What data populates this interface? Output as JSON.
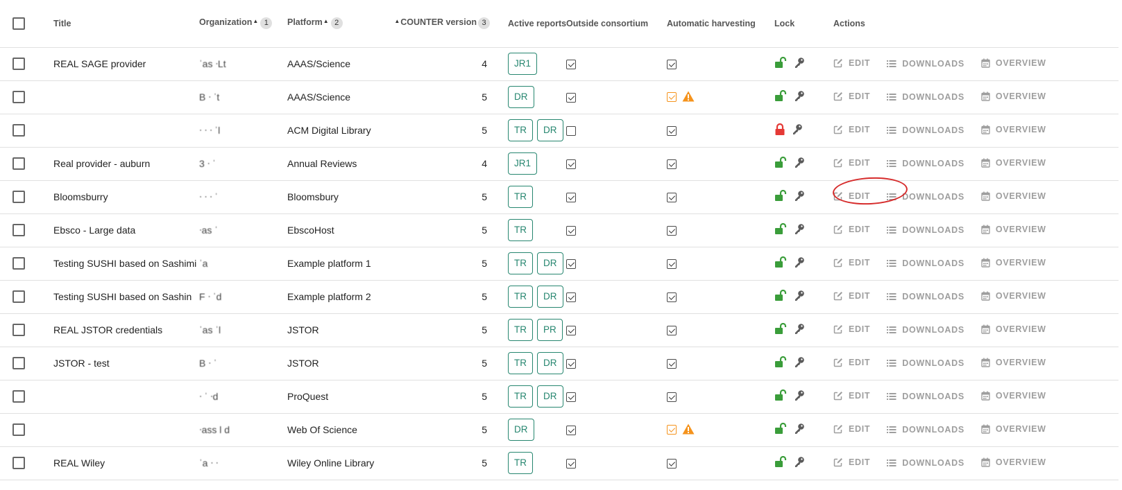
{
  "header": {
    "title": "Title",
    "organization": "Organization",
    "organization_sort": "1",
    "platform": "Platform",
    "platform_sort": "2",
    "counter_version": "COUNTER version",
    "counter_sort": "3",
    "active_reports": "Active reports",
    "outside_consortium": "Outside consortium",
    "automatic_harvesting": "Automatic harvesting",
    "lock": "Lock",
    "actions": "Actions"
  },
  "actions": {
    "edit": "EDIT",
    "downloads": "DOWNLOADS",
    "overview": "OVERVIEW"
  },
  "colors": {
    "accent": "#26866f",
    "unlocked": "#3a9d3a",
    "locked": "#e53935",
    "warning": "#f5931c",
    "action_text": "#9e9e9e",
    "highlight": "#d62b2b"
  },
  "rows": [
    {
      "title": "REAL SAGE provider",
      "org": "ˈas  ᐧLt",
      "platform": "AAAS/Science",
      "version": "4",
      "reports": [
        "JR1"
      ],
      "outside": true,
      "harvest": true,
      "harvest_warn": false,
      "locked": false
    },
    {
      "title": "",
      "org": "B ᐧ  ˈt",
      "platform": "AAAS/Science",
      "version": "5",
      "reports": [
        "DR"
      ],
      "outside": true,
      "harvest": true,
      "harvest_warn": true,
      "locked": false
    },
    {
      "title": "",
      "org": "ᐧ ᐧ  ᐧ  ˈl",
      "platform": "ACM Digital Library",
      "version": "5",
      "reports": [
        "TR",
        "DR"
      ],
      "outside": false,
      "harvest": true,
      "harvest_warn": false,
      "locked": true
    },
    {
      "title": "Real provider - auburn",
      "org": "3 ᐧ  ˈ",
      "platform": "Annual Reviews",
      "version": "4",
      "reports": [
        "JR1"
      ],
      "outside": true,
      "harvest": true,
      "harvest_warn": false,
      "locked": false
    },
    {
      "title": "Bloomsburry",
      "org": "ᐧ ᐧ ᐧ  ˈ",
      "platform": "Bloomsbury",
      "version": "5",
      "reports": [
        "TR"
      ],
      "outside": true,
      "harvest": true,
      "harvest_warn": false,
      "locked": false
    },
    {
      "title": "Ebsco - Large data",
      "org": "ᐧas ˈ",
      "platform": "EbscoHost",
      "version": "5",
      "reports": [
        "TR"
      ],
      "outside": true,
      "harvest": true,
      "harvest_warn": false,
      "locked": false
    },
    {
      "title": "Testing SUSHI based on Sashimi",
      "org": "ˈa",
      "platform": "Example platform 1",
      "version": "5",
      "reports": [
        "TR",
        "DR"
      ],
      "outside": true,
      "harvest": true,
      "harvest_warn": false,
      "locked": false
    },
    {
      "title": "Testing SUSHI based on Sashin",
      "org": "F  ᐧ  ˈd",
      "platform": "Example platform 2",
      "version": "5",
      "reports": [
        "TR",
        "DR"
      ],
      "outside": true,
      "harvest": true,
      "harvest_warn": false,
      "locked": false
    },
    {
      "title": "REAL JSTOR credentials",
      "org": "ˈas  ˈl",
      "platform": "JSTOR",
      "version": "5",
      "reports": [
        "TR",
        "PR"
      ],
      "outside": true,
      "harvest": true,
      "harvest_warn": false,
      "locked": false
    },
    {
      "title": "JSTOR - test",
      "org": "B ᐧ  ˈ",
      "platform": "JSTOR",
      "version": "5",
      "reports": [
        "TR",
        "DR"
      ],
      "outside": true,
      "harvest": true,
      "harvest_warn": false,
      "locked": false
    },
    {
      "title": "",
      "org": "ᐧ  ˈ ᐧd",
      "platform": "ProQuest",
      "version": "5",
      "reports": [
        "TR",
        "DR"
      ],
      "outside": true,
      "harvest": true,
      "harvest_warn": false,
      "locked": false
    },
    {
      "title": "",
      "org": "ᐧass l d",
      "platform": "Web Of Science",
      "version": "5",
      "reports": [
        "DR"
      ],
      "outside": true,
      "harvest": true,
      "harvest_warn": true,
      "locked": false
    },
    {
      "title": "REAL Wiley",
      "org": "ˈa  ᐧ ᐧ",
      "platform": "Wiley Online Library",
      "version": "5",
      "reports": [
        "TR"
      ],
      "outside": true,
      "harvest": true,
      "harvest_warn": false,
      "locked": false
    }
  ]
}
